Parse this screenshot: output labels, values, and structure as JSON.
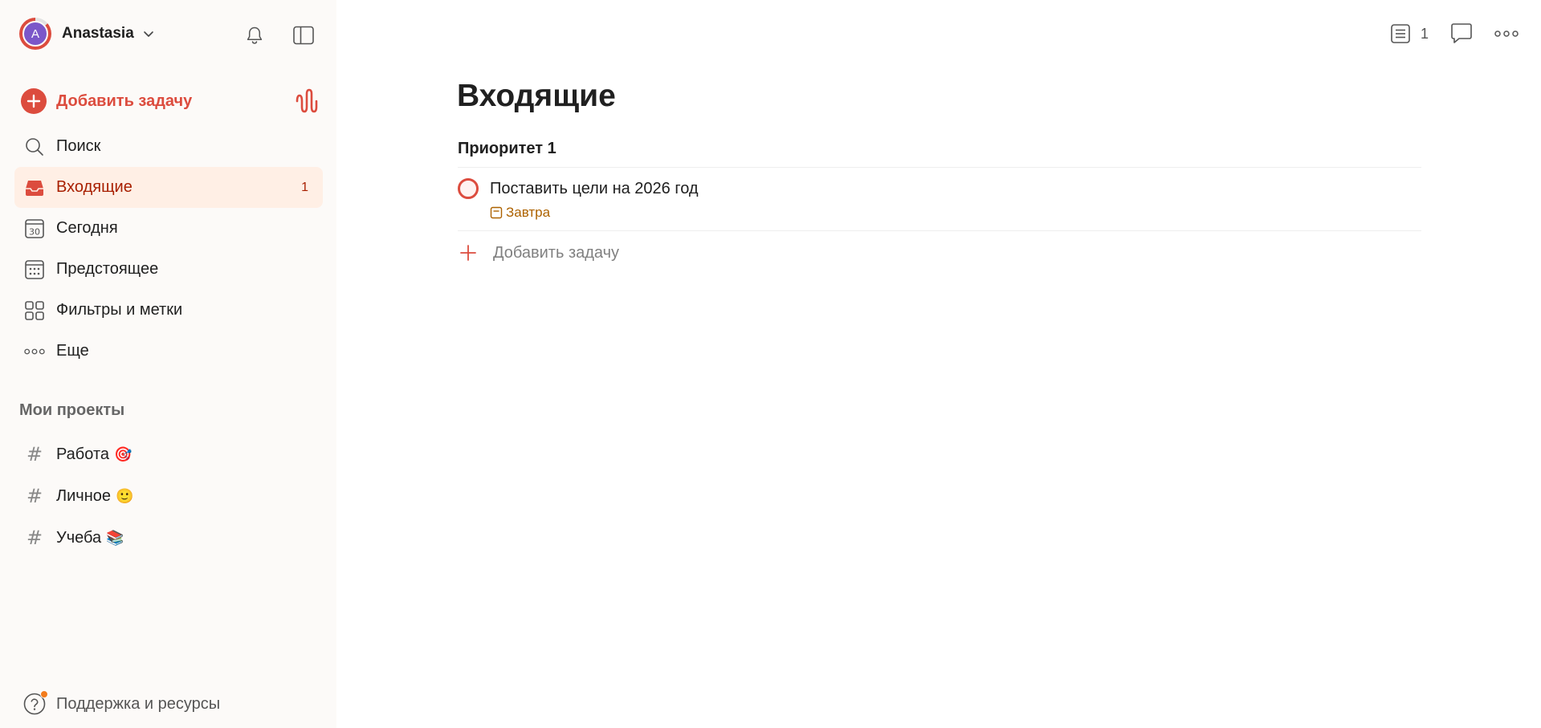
{
  "user": {
    "initial": "A",
    "name": "Anastasia"
  },
  "icons": {
    "chevron": "chevron-down-icon",
    "bell": "bell-icon",
    "sidebar_toggle": "sidebar-toggle-icon",
    "ramble": "waveform-icon"
  },
  "sidebar": {
    "add_task": "Добавить задачу",
    "nav": [
      {
        "label": "Поиск",
        "icon": "search-icon"
      },
      {
        "label": "Входящие",
        "icon": "inbox-icon",
        "count": "1",
        "active": true
      },
      {
        "label": "Сегодня",
        "icon": "calendar-today-icon",
        "day": "30"
      },
      {
        "label": "Предстоящее",
        "icon": "calendar-grid-icon"
      },
      {
        "label": "Фильтры и метки",
        "icon": "filters-grid-icon"
      },
      {
        "label": "Еще",
        "icon": "more-horizontal-icon"
      }
    ],
    "projects_title": "Мои проекты",
    "projects": [
      {
        "label": "Работа",
        "emoji": "🎯"
      },
      {
        "label": "Личное",
        "emoji": "🙂"
      },
      {
        "label": "Учеба",
        "emoji": "📚"
      }
    ],
    "support": "Поддержка и ресурсы"
  },
  "topbar": {
    "list_count": "1"
  },
  "main": {
    "title": "Входящие",
    "section_title": "Приоритет 1",
    "task": {
      "title": "Поставить цели на 2026 год",
      "due": "Завтра"
    },
    "add_task": "Добавить задачу"
  },
  "colors": {
    "accent": "#dc4c3e",
    "active_bg": "#ffefe5",
    "active_text": "#a81f00",
    "due": "#ad6200",
    "sidebar_bg": "#fcfaf8",
    "avatar": "#7b57c9"
  }
}
